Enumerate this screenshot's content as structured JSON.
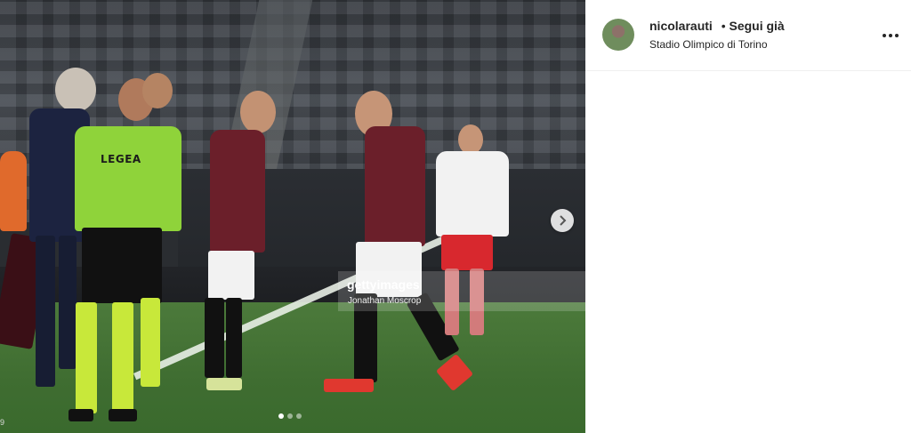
{
  "post": {
    "image_alt": "Match photo",
    "watermark_logo": "gettyimages",
    "watermark_credit": "Jonathan Moscrop",
    "corner_text": "9",
    "shirt_text": "LEGEA",
    "carousel_total": 3,
    "carousel_active": 1
  },
  "header": {
    "username": "nicolarauti",
    "separator": "•",
    "follow_label": "Segui già",
    "location": "Stadio Olimpico di Torino"
  },
  "colors": {
    "referee_shirt": "#8fd33a",
    "home_shirt": "#6b1f2a",
    "away_shirt": "#f2f2f2",
    "away_shorts": "#d8282e"
  }
}
